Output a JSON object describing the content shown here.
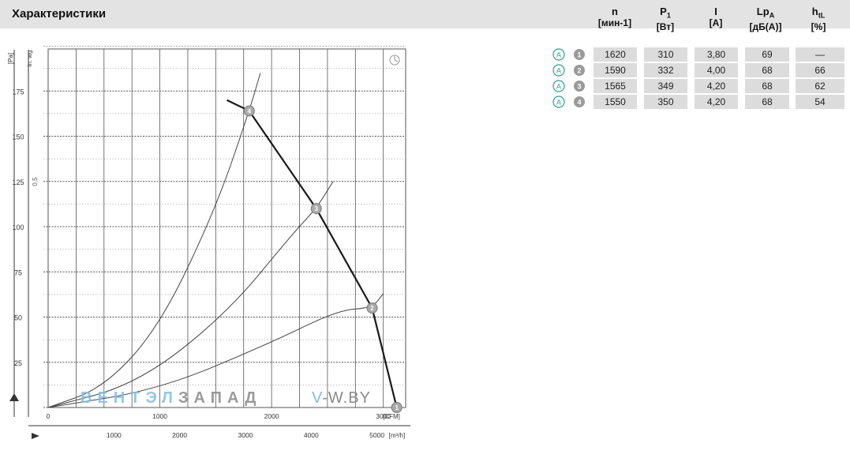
{
  "header": {
    "title": "Характеристики",
    "columns": [
      {
        "symbol": "n",
        "sub": "",
        "unit": "[мин-1]"
      },
      {
        "symbol": "P",
        "sub": "1",
        "unit": "[Вт]"
      },
      {
        "symbol": "I",
        "sub": "",
        "unit": "[A]"
      },
      {
        "symbol": "Lp",
        "sub": "A",
        "unit": "[дБ(A)]"
      },
      {
        "symbol": "h",
        "sub": "tL",
        "unit": "[%]"
      }
    ]
  },
  "table": {
    "marker_letter": "A",
    "rows": [
      {
        "num": "1",
        "values": [
          "1620",
          "310",
          "3,80",
          "69",
          "—"
        ]
      },
      {
        "num": "2",
        "values": [
          "1590",
          "332",
          "4,00",
          "68",
          "66"
        ]
      },
      {
        "num": "3",
        "values": [
          "1565",
          "349",
          "4,20",
          "68",
          "62"
        ]
      },
      {
        "num": "4",
        "values": [
          "1550",
          "350",
          "4,20",
          "68",
          "54"
        ]
      }
    ]
  },
  "watermark": {
    "brand_a": "ВЕНТЭЛ",
    "brand_b": "ЗАПАД",
    "site_a": "V",
    "site_b": "-W.BY"
  },
  "colors": {
    "grid": "#555555",
    "curve": "#1a1a1a",
    "point": "#aaaaaa",
    "accent": "#2aa198",
    "cell_bg": "#dcdcdc"
  },
  "chart_data": {
    "type": "line",
    "title": "",
    "grid": true,
    "x_primary": {
      "unit_label": "[CFM]",
      "range": [
        0,
        3200
      ],
      "ticks": [
        0,
        1000,
        2000,
        3000
      ],
      "tick_labels": [
        "0",
        "1000",
        "2000",
        "3000"
      ]
    },
    "x_secondary": {
      "unit_label": "[m³/h]",
      "ticks": [
        1000,
        2000,
        3000,
        4000,
        5000
      ],
      "tick_labels": [
        "1000",
        "2000",
        "3000",
        "4000",
        "5000"
      ]
    },
    "y_primary": {
      "unit_label": "[Pa]",
      "range": [
        0,
        200
      ],
      "ticks": [
        25,
        50,
        75,
        100,
        125,
        150,
        175
      ],
      "tick_labels": [
        "25",
        "50",
        "75",
        "100",
        "125",
        "150",
        "175"
      ]
    },
    "y_secondary": {
      "unit_label": "in. wg",
      "tick_labels": [
        "0,5"
      ]
    },
    "series": [
      {
        "x": [
          1600,
          1800,
          2400,
          2900,
          3120
        ],
        "y": [
          170,
          164,
          110,
          55,
          0
        ]
      }
    ],
    "system_curves": [
      {
        "x": [
          0,
          500,
          1000,
          1500,
          1800,
          1900
        ],
        "y": [
          0,
          11,
          45,
          110,
          164,
          185
        ]
      },
      {
        "x": [
          0,
          800,
          1600,
          2200,
          2400,
          2550
        ],
        "y": [
          0,
          13,
          52,
          97,
          110,
          125
        ]
      },
      {
        "x": [
          0,
          1000,
          2000,
          2600,
          2900,
          3000
        ],
        "y": [
          0,
          10,
          36,
          54,
          55,
          63
        ]
      }
    ],
    "operating_points": [
      {
        "label": "1",
        "x": 3120,
        "y": 0
      },
      {
        "label": "2",
        "x": 2900,
        "y": 55
      },
      {
        "label": "3",
        "x": 2400,
        "y": 110
      },
      {
        "label": "4",
        "x": 1800,
        "y": 164
      }
    ]
  }
}
